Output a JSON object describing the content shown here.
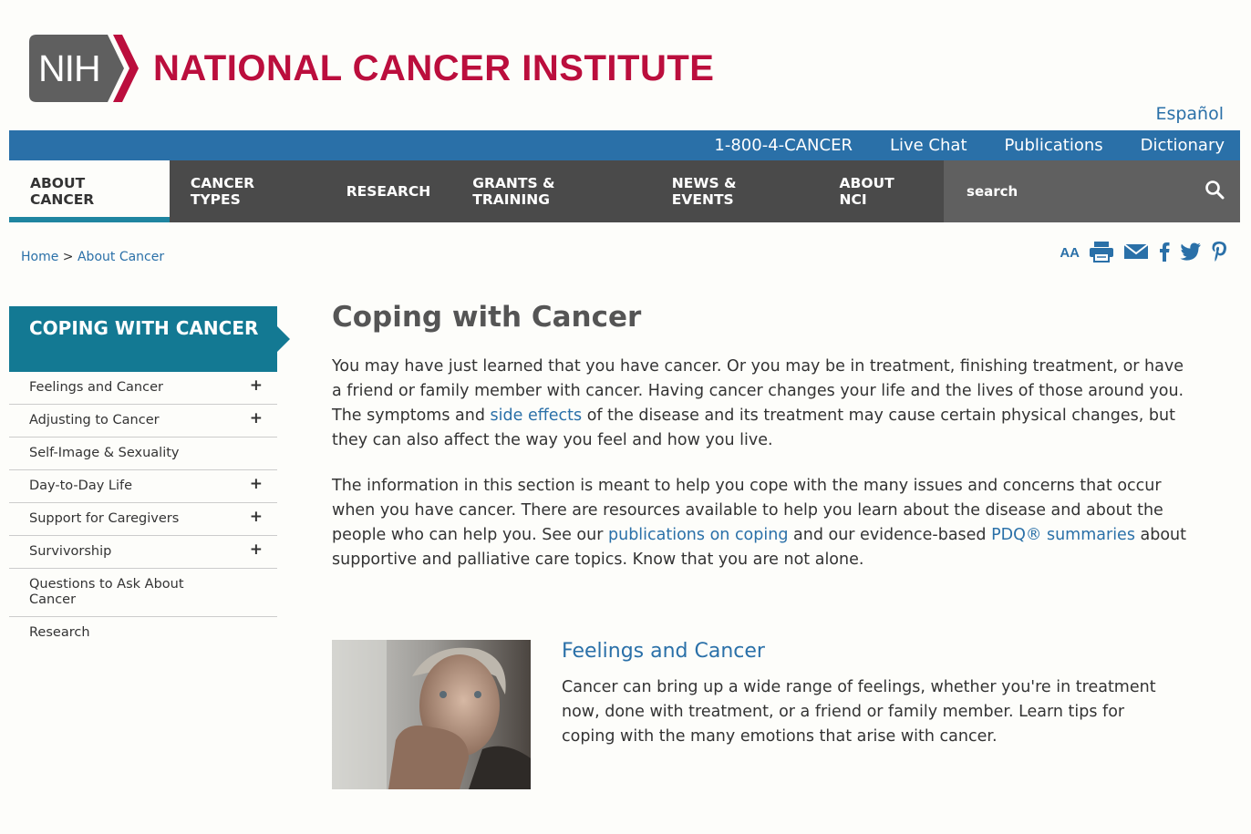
{
  "header": {
    "nih_badge": "NIH",
    "institute": "NATIONAL CANCER INSTITUTE",
    "language_link": "Español"
  },
  "utility_nav": [
    "1-800-4-CANCER",
    "Live Chat",
    "Publications",
    "Dictionary"
  ],
  "main_nav": [
    "ABOUT CANCER",
    "CANCER TYPES",
    "RESEARCH",
    "GRANTS & TRAINING",
    "NEWS & EVENTS",
    "ABOUT NCI"
  ],
  "search": {
    "placeholder": "search"
  },
  "breadcrumb": {
    "home": "Home",
    "separator": ">",
    "current": "About Cancer"
  },
  "share_icons": [
    "font-resize-icon",
    "print-icon",
    "email-icon",
    "facebook-icon",
    "twitter-icon",
    "pinterest-icon"
  ],
  "font_resize_label": "AA",
  "sidebar": {
    "heading": "COPING WITH CANCER",
    "items": [
      {
        "label": "Feelings and Cancer",
        "expand": "+"
      },
      {
        "label": "Adjusting to Cancer",
        "expand": "+"
      },
      {
        "label": "Self-Image & Sexuality",
        "expand": ""
      },
      {
        "label": "Day-to-Day Life",
        "expand": "+"
      },
      {
        "label": "Support for Caregivers",
        "expand": "+"
      },
      {
        "label": "Survivorship",
        "expand": "+"
      },
      {
        "label": "Questions to Ask About Cancer",
        "expand": ""
      },
      {
        "label": "Research",
        "expand": ""
      }
    ]
  },
  "main": {
    "title": "Coping with Cancer",
    "p1": {
      "before": "You may have just learned that you have cancer. Or you may be in treatment, finishing treatment, or have a friend or family member with cancer. Having cancer changes your life and the lives of those around you. The symptoms and ",
      "link": "side effects",
      "after": " of the disease and its treatment may cause certain physical changes, but they can also affect the way you feel and how you live."
    },
    "p2": {
      "before": "The information in this section is meant to help you cope with the many issues and concerns that occur when you have cancer. There are resources available to help you learn about the disease and about the people who can help you. See our ",
      "link1": "publications on coping",
      "middle": " and our evidence-based ",
      "link2": "PDQ® summaries",
      "after": " about supportive and palliative care topics. Know that you are not alone."
    },
    "feature": {
      "title": "Feelings and Cancer",
      "text": "Cancer can bring up a wide range of feelings, whether you're in treatment now, done with treatment, or a friend or family member. Learn tips for coping with the many emotions that arise with cancer."
    }
  },
  "colors": {
    "brand_red": "#bb0e3d",
    "utility_blue": "#2a70a8",
    "nav_dark": "#4a4a4a",
    "sidebar_teal": "#137993",
    "link": "#2a70a8"
  }
}
